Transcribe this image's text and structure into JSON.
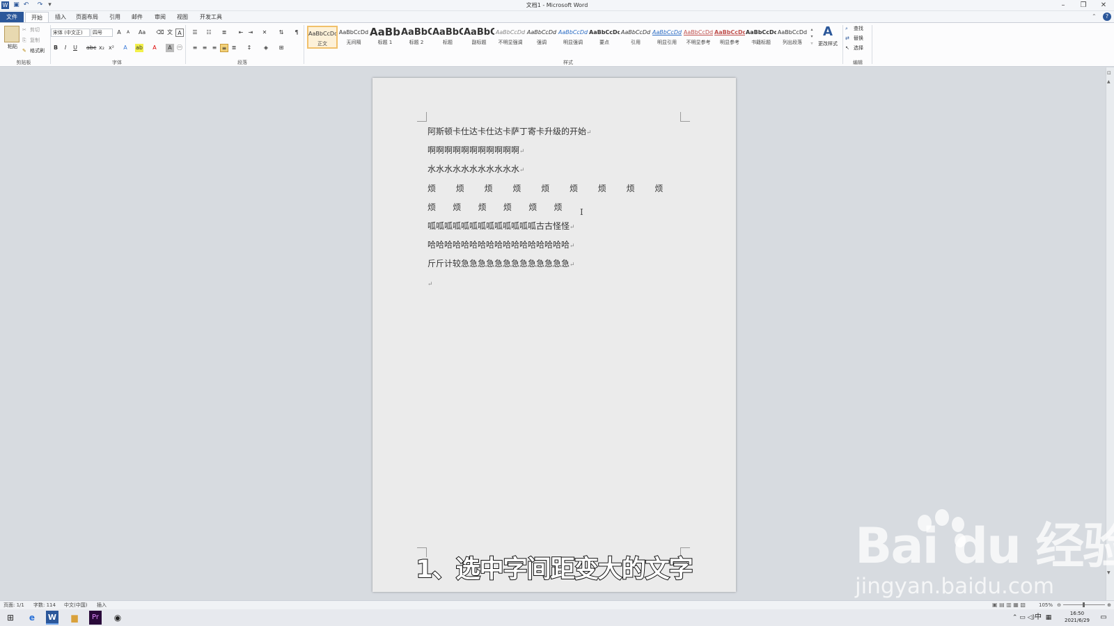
{
  "window": {
    "title": "文档1 - Microsoft Word"
  },
  "tabs": [
    "文件",
    "开始",
    "插入",
    "页面布局",
    "引用",
    "邮件",
    "审阅",
    "视图",
    "开发工具"
  ],
  "clipboard": {
    "paste": "粘贴",
    "cut": "剪切",
    "copy": "复制",
    "format_painter": "格式刷",
    "group": "剪贴板"
  },
  "font": {
    "name": "宋体 (中文正)",
    "size": "四号",
    "group": "字体"
  },
  "paragraph": {
    "group": "段落"
  },
  "styles": {
    "group": "样式",
    "items": [
      {
        "preview": "AaBbCcDd",
        "name": "正文"
      },
      {
        "preview": "AaBbCcDd",
        "name": "无间隔"
      },
      {
        "preview": "AaBb",
        "name": "标题 1"
      },
      {
        "preview": "AaBbC",
        "name": "标题 2"
      },
      {
        "preview": "AaBbC",
        "name": "标题"
      },
      {
        "preview": "AaBbC",
        "name": "副标题"
      },
      {
        "preview": "AaBbCcDd",
        "name": "不明显强调"
      },
      {
        "preview": "AaBbCcDd",
        "name": "强调"
      },
      {
        "preview": "AaBbCcDd",
        "name": "明显强调"
      },
      {
        "preview": "AaBbCcDd",
        "name": "要点"
      },
      {
        "preview": "AaBbCcDd",
        "name": "引用"
      },
      {
        "preview": "AaBbCcDd",
        "name": "明显引用"
      },
      {
        "preview": "AaBbCcDd",
        "name": "不明显参考"
      },
      {
        "preview": "AaBbCcDd",
        "name": "明显参考"
      },
      {
        "preview": "AaBbCcDd",
        "name": "书籍标题"
      },
      {
        "preview": "AaBbCcDd",
        "name": "列出段落"
      }
    ],
    "change": "更改样式"
  },
  "editing": {
    "find": "查找",
    "replace": "替换",
    "select": "选择",
    "group": "编辑"
  },
  "document": {
    "lines": [
      "阿斯顿卡仕达卡仕达卡萨丁寄卡升级的开始",
      "啊啊啊啊啊啊啊啊啊啊啊",
      "水水水水水水水水水水水",
      "烦",
      "烦",
      "呱呱呱呱呱呱呱呱呱呱呱呱呱古古怪怪",
      "哈哈哈哈哈哈哈哈哈哈哈哈哈哈哈哈哈",
      "斤斤计较急急急急急急急急急急急急急"
    ],
    "spread_count_1": 9,
    "spread_count_2": 6,
    "paragraph_mark": "↵"
  },
  "caption": "1、选中字间距变大的文字",
  "watermark": {
    "logo": "Bai du 经验",
    "url": "jingyan.baidu.com"
  },
  "status": {
    "page": "页面: 1/1",
    "words": "字数: 114",
    "language": "中文(中国)",
    "mode": "插入",
    "zoom": "105%"
  },
  "taskbar": {
    "time": "16:50",
    "date": "2021/6/29",
    "ime": "中"
  }
}
